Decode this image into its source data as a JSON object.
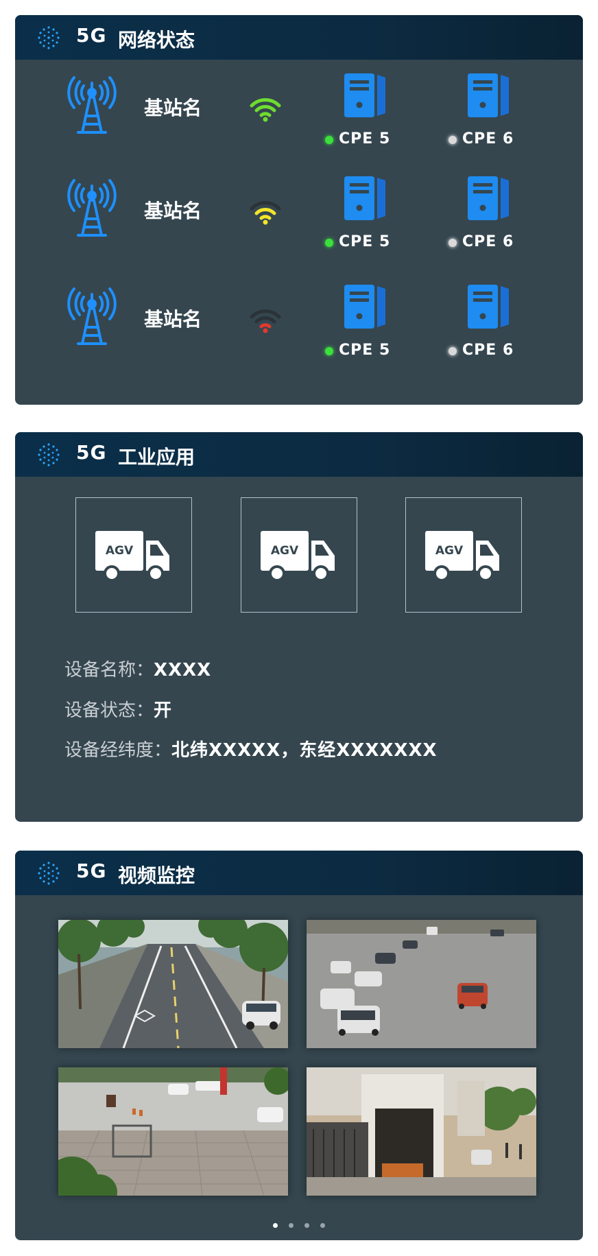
{
  "network_panel": {
    "prefix": "5G",
    "title": "网络状态",
    "rows": [
      {
        "station": "基站名",
        "signal_level": "strong",
        "signal_color": "#6fdc2f",
        "cpes": [
          {
            "label": "CPE 5",
            "status": "online",
            "status_color": "#3be03b"
          },
          {
            "label": "CPE 6",
            "status": "offline",
            "status_color": "#d9d9d9"
          }
        ]
      },
      {
        "station": "基站名",
        "signal_level": "medium",
        "signal_color": "#f2e52a",
        "cpes": [
          {
            "label": "CPE 5",
            "status": "online",
            "status_color": "#3be03b"
          },
          {
            "label": "CPE 6",
            "status": "offline",
            "status_color": "#d9d9d9"
          }
        ]
      },
      {
        "station": "基站名",
        "signal_level": "weak",
        "signal_color": "#e03a2f",
        "cpes": [
          {
            "label": "CPE 5",
            "status": "online",
            "status_color": "#3be03b"
          },
          {
            "label": "CPE 6",
            "status": "offline",
            "status_color": "#d9d9d9"
          }
        ]
      }
    ],
    "icons": {
      "station": "signal-tower-icon",
      "cpe": "computer-tower-icon"
    },
    "accent_color": "#1e90ff"
  },
  "industry_panel": {
    "prefix": "5G",
    "title": "工业应用",
    "vehicles": [
      {
        "label": "AGV"
      },
      {
        "label": "AGV"
      },
      {
        "label": "AGV"
      }
    ],
    "info": {
      "name_label": "设备名称：",
      "name_value": "XXXX",
      "status_label": "设备状态：",
      "status_value": "开",
      "location_label": "设备经纬度：",
      "location_value": "北纬XXXXX，东经XXXXXXX"
    }
  },
  "video_panel": {
    "prefix": "5G",
    "title": "视频监控",
    "feeds": [
      {
        "scene": "tree-lined road with lane markings"
      },
      {
        "scene": "wide intersection traffic"
      },
      {
        "scene": "plaza with vehicles"
      },
      {
        "scene": "building gate entrance"
      }
    ],
    "pager": {
      "count": 4,
      "active": 0
    }
  }
}
